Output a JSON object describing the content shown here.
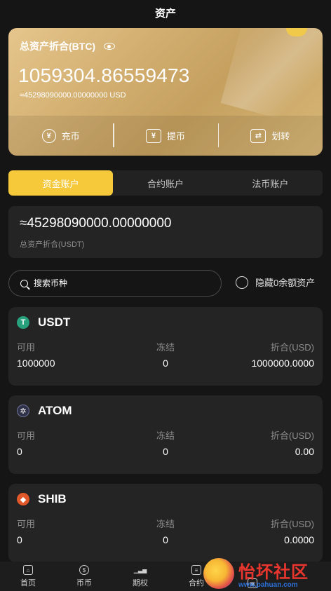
{
  "header": {
    "title": "资产"
  },
  "asset_card": {
    "label": "总资产折合(BTC)",
    "btc_value": "1059304.86559473",
    "usd_approx": "≈45298090000.00000000 USD",
    "actions": [
      {
        "label": "充币",
        "icon": "deposit-icon"
      },
      {
        "label": "提币",
        "icon": "withdraw-icon"
      },
      {
        "label": "划转",
        "icon": "transfer-icon"
      }
    ]
  },
  "tabs": [
    {
      "label": "资金账户",
      "active": true
    },
    {
      "label": "合约账户",
      "active": false
    },
    {
      "label": "法币账户",
      "active": false
    }
  ],
  "total": {
    "value": "≈45298090000.00000000",
    "label": "总资产折合(USDT)"
  },
  "search": {
    "placeholder": "搜索币种",
    "value": ""
  },
  "hide_zero": {
    "label": "隐藏0余额资产",
    "checked": false
  },
  "column_labels": {
    "available": "可用",
    "frozen": "冻结",
    "converted": "折合(USD)"
  },
  "coins": [
    {
      "symbol": "USDT",
      "icon": "usdt-icon",
      "color": "#26a17b",
      "available": "1000000",
      "frozen": "0",
      "converted": "1000000.0000"
    },
    {
      "symbol": "ATOM",
      "icon": "atom-icon",
      "color": "#2e3148",
      "available": "0",
      "frozen": "0",
      "converted": "0.00"
    },
    {
      "symbol": "SHIB",
      "icon": "shib-icon",
      "color": "#e0582a",
      "available": "0",
      "frozen": "0",
      "converted": "0.0000"
    }
  ],
  "bottom_nav": [
    {
      "label": "首页",
      "icon": "home-icon"
    },
    {
      "label": "币币",
      "icon": "coin-icon"
    },
    {
      "label": "期权",
      "icon": "chart-icon"
    },
    {
      "label": "合约",
      "icon": "contract-icon"
    },
    {
      "label": "",
      "icon": "assets-icon"
    },
    {
      "label": "",
      "icon": "assets-icon"
    }
  ],
  "watermark": {
    "title": "怡坏社区",
    "url": "www.pahuan.com"
  },
  "colors": {
    "accent": "#f5c93a",
    "card_gold": "#d2ae70",
    "background": "#151515"
  }
}
